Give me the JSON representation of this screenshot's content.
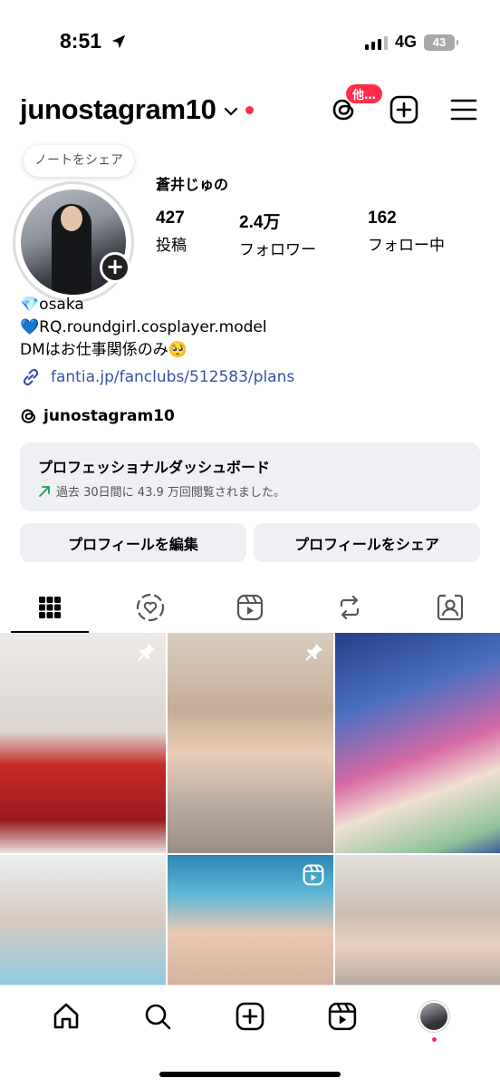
{
  "status_bar": {
    "time": "8:51",
    "network": "4G",
    "battery": "43"
  },
  "header": {
    "username": "junostagram10",
    "threads_badge": "他…"
  },
  "profile": {
    "note_placeholder": "ノートをシェア",
    "display_name": "蒼井じゅの",
    "stats": [
      {
        "value": "427",
        "label": "投稿"
      },
      {
        "value": "2.4万",
        "label": "フォロワー"
      },
      {
        "value": "162",
        "label": "フォロー中"
      }
    ]
  },
  "bio": {
    "lines": [
      "💎osaka",
      "💙RQ.roundgirl.cosplayer.model",
      "DMはお仕事関係のみ🥺"
    ],
    "link": "fantia.jp/fanclubs/512583/plans",
    "threads_handle": "junostagram10"
  },
  "dashboard": {
    "title": "プロフェッショナルダッシュボード",
    "subtitle": "過去 30日間に 43.9 万回閲覧されました。",
    "accent_color": "#1e9a52"
  },
  "buttons": {
    "edit": "プロフィールを編集",
    "share": "プロフィールをシェア"
  },
  "tabs": [
    "posts-grid-icon",
    "collab-icon",
    "reels-icon",
    "reposts-icon",
    "tagged-icon"
  ],
  "grid": [
    {
      "pinned": true,
      "colors": [
        "#e7e3df",
        "#b9201f"
      ]
    },
    {
      "pinned": true,
      "colors": [
        "#d7c7b3",
        "#a9988a"
      ]
    },
    {
      "pinned": false,
      "colors": [
        "#3a5fa8",
        "#d95c9c"
      ]
    },
    {
      "pinned": false,
      "colors": [
        "#e2e5e8",
        "#96d0e2"
      ]
    },
    {
      "pinned": false,
      "reel": true,
      "colors": [
        "#3b9fc4",
        "#e9c6b0"
      ]
    },
    {
      "pinned": false,
      "colors": [
        "#dcd8d4",
        "#b7aaa0"
      ]
    }
  ],
  "brand_colors": {
    "notification": "#ff2d4b",
    "link": "#3a50a8"
  }
}
